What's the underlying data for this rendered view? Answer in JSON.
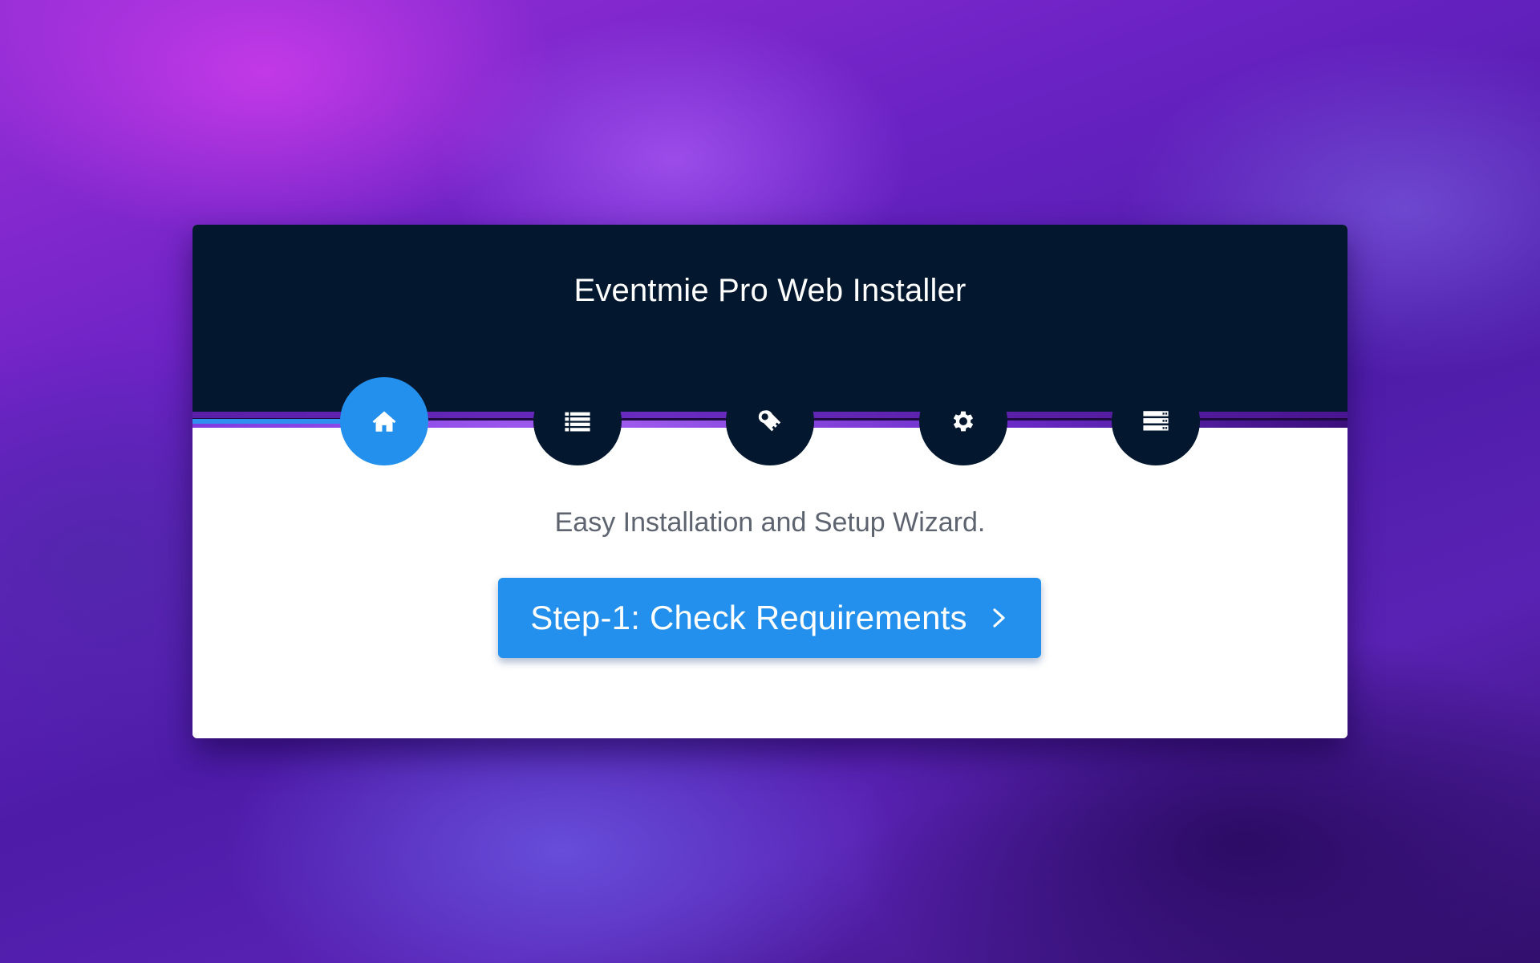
{
  "installer": {
    "title": "Eventmie Pro Web Installer",
    "subtitle": "Easy Installation and Setup Wizard.",
    "primary_button": {
      "label": "Step-1: Check Requirements",
      "icon": "chevron-right-icon"
    },
    "steps": [
      {
        "icon": "home-icon",
        "active": true
      },
      {
        "icon": "list-icon",
        "active": false
      },
      {
        "icon": "key-icon",
        "active": false
      },
      {
        "icon": "gear-icon",
        "active": false
      },
      {
        "icon": "server-icon",
        "active": false
      }
    ]
  },
  "colors": {
    "header_bg": "#03172e",
    "accent": "#2490ee",
    "card_bg": "#ffffff",
    "subtitle_text": "#5d6470"
  }
}
